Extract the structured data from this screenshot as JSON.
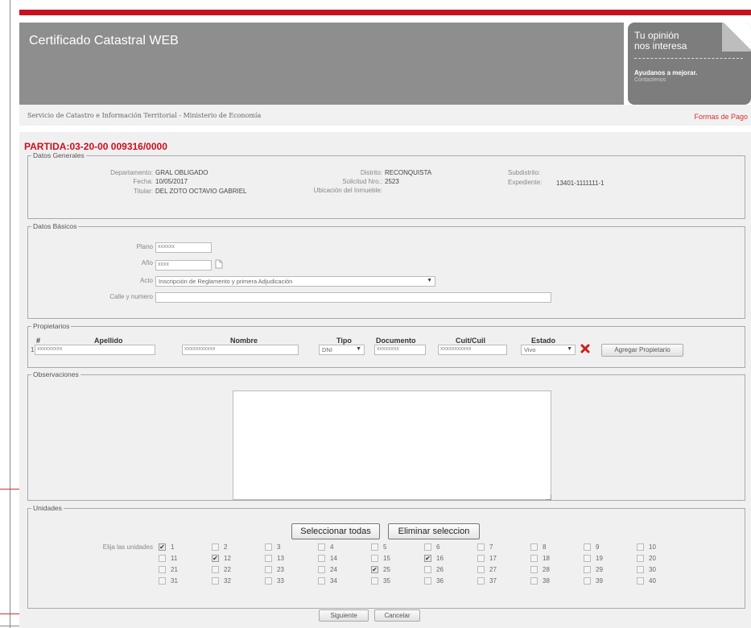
{
  "app": {
    "title": "Certificado Catastral WEB",
    "feedback": {
      "line1": "Tu opinión",
      "line2": "nos interesa",
      "help": "Ayudanos a mejorar.",
      "contact": "Contactenos"
    },
    "ministry": "Servicio de Catastro e Información Territorial - Ministerio de Economía",
    "payment_link": "Formas de Pago",
    "partida": "PARTIDA:03-20-00 009316/0000"
  },
  "datos_generales": {
    "legend": "Datos Generales",
    "departamento_label": "Departamento:",
    "departamento": "GRAL OBLIGADO",
    "fecha_label": "Fecha:",
    "fecha": "10/05/2017",
    "titular_label": "Titular:",
    "titular": "DEL ZOTO OCTAVIO GABRIEL",
    "distrito_label": "Distrito:",
    "distrito": "RECONQUISTA",
    "solicitud_label": "Solicitud Nro.:",
    "solicitud": "2523",
    "ubicacion_label": "Ubicación del Inmueble:",
    "subdistrito_label": "Subdistrito:",
    "expediente_label": "Expediente:",
    "expediente": "13401-1111111-1"
  },
  "datos_basicos": {
    "legend": "Datos Básicos",
    "plano_label": "Plano",
    "plano": "xxxxxx",
    "anio_label": "Año",
    "anio": "xxxx",
    "acto_label": "Acto",
    "acto": "Inscripción de Reglamento y primera Adjudicación",
    "calle_label": "Calle y numero",
    "calle": ""
  },
  "propietarios": {
    "legend": "Propietarios",
    "headers": {
      "num": "#",
      "apellido": "Apellido",
      "nombre": "Nombre",
      "tipo": "Tipo",
      "documento": "Documento",
      "cuit": "Cuit/Cuil",
      "estado": "Estado"
    },
    "row": {
      "num": "1",
      "apellido": "xxxxxxxxx",
      "nombre": "xxxxxxxxxxx",
      "tipo": "DNI",
      "documento": "xxxxxxxx",
      "cuit": "xxxxxxxxxxx",
      "estado": "Vivo"
    },
    "add_button": "Agregar Propietario"
  },
  "observaciones": {
    "legend": "Observaciones",
    "text": ""
  },
  "unidades": {
    "legend": "Unidades",
    "select_all": "Seleccionar todas",
    "clear": "Eliminar seleccion",
    "elija_label": "Elija las unidades",
    "checked": [
      1,
      12,
      16,
      25
    ],
    "total": 40
  },
  "footer": {
    "next": "Siguiente",
    "cancel": "Cancelar"
  }
}
